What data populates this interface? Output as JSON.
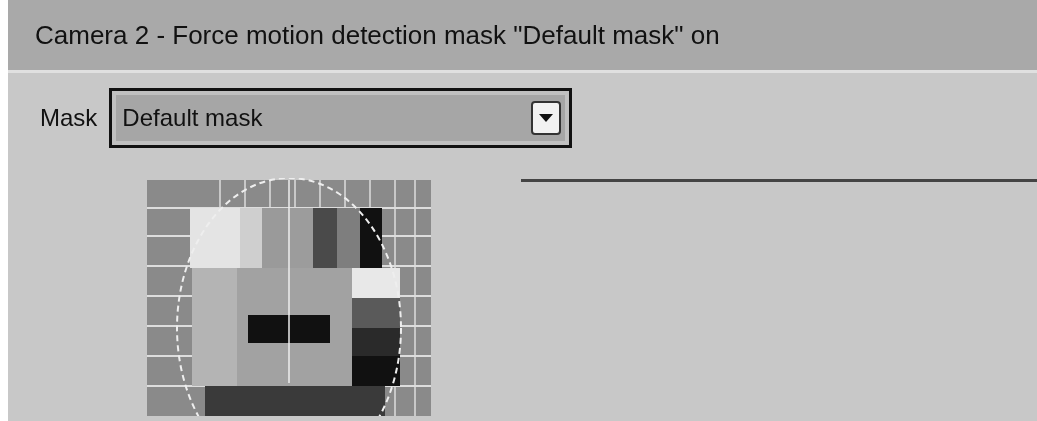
{
  "header": {
    "title": "Camera 2 - Force motion detection mask \"Default mask\" on"
  },
  "mask": {
    "label": "Mask",
    "value": "Default mask"
  }
}
